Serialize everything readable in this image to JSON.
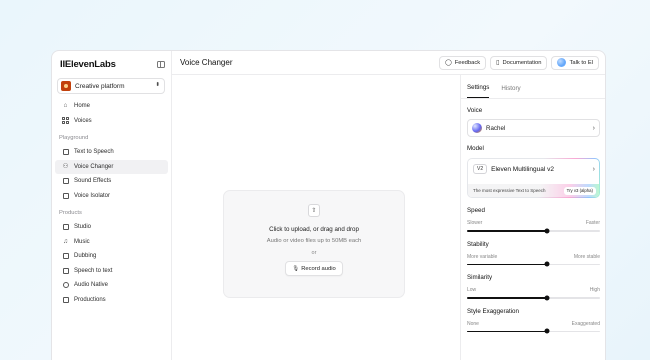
{
  "sidebar": {
    "logo": "IIElevenLabs",
    "workspace": "Creative platform",
    "top_items": [
      {
        "label": "Home",
        "icon": "home-icon"
      },
      {
        "label": "Voices",
        "icon": "voices-icon"
      }
    ],
    "playground": {
      "label": "Playground",
      "items": [
        {
          "label": "Text to Speech",
          "icon": "text-to-speech-icon"
        },
        {
          "label": "Voice Changer",
          "icon": "voice-changer-icon",
          "active": true
        },
        {
          "label": "Sound Effects",
          "icon": "sound-effects-icon"
        },
        {
          "label": "Voice Isolator",
          "icon": "voice-isolator-icon"
        }
      ]
    },
    "products": {
      "label": "Products",
      "items": [
        {
          "label": "Studio",
          "icon": "studio-icon"
        },
        {
          "label": "Music",
          "icon": "music-icon"
        },
        {
          "label": "Dubbing",
          "icon": "dubbing-icon"
        },
        {
          "label": "Speech to text",
          "icon": "speech-to-text-icon"
        },
        {
          "label": "Audio Native",
          "icon": "audio-native-icon"
        },
        {
          "label": "Productions",
          "icon": "productions-icon"
        }
      ]
    }
  },
  "header": {
    "title": "Voice Changer",
    "feedback": "Feedback",
    "documentation": "Documentation",
    "talk": "Talk to El"
  },
  "dropzone": {
    "title": "Click to upload, or drag and drop",
    "subtitle": "Audio or video files up to 50MB each",
    "or": "or",
    "record": "Record audio"
  },
  "settings": {
    "tabs": [
      "Settings",
      "History"
    ],
    "active_tab": "Settings",
    "voice_label": "Voice",
    "voice": "Rachel",
    "model_label": "Model",
    "model": {
      "badge": "V2",
      "name": "Eleven Multilingual v2",
      "description": "The most expressive Text to Speech",
      "try_label": "Try v3 (alpha)"
    },
    "sliders": [
      {
        "label": "Speed",
        "min_label": "Slower",
        "max_label": "Faster",
        "value": 0.6
      },
      {
        "label": "Stability",
        "min_label": "More variable",
        "max_label": "More stable",
        "value": 0.6
      },
      {
        "label": "Similarity",
        "min_label": "Low",
        "max_label": "High",
        "value": 0.6
      },
      {
        "label": "Style Exaggeration",
        "min_label": "None",
        "max_label": "Exaggerated",
        "value": 0.6
      }
    ]
  },
  "colors": {
    "background": "#eaf6fc",
    "accent": "#111111",
    "border": "#e4e4e7"
  }
}
